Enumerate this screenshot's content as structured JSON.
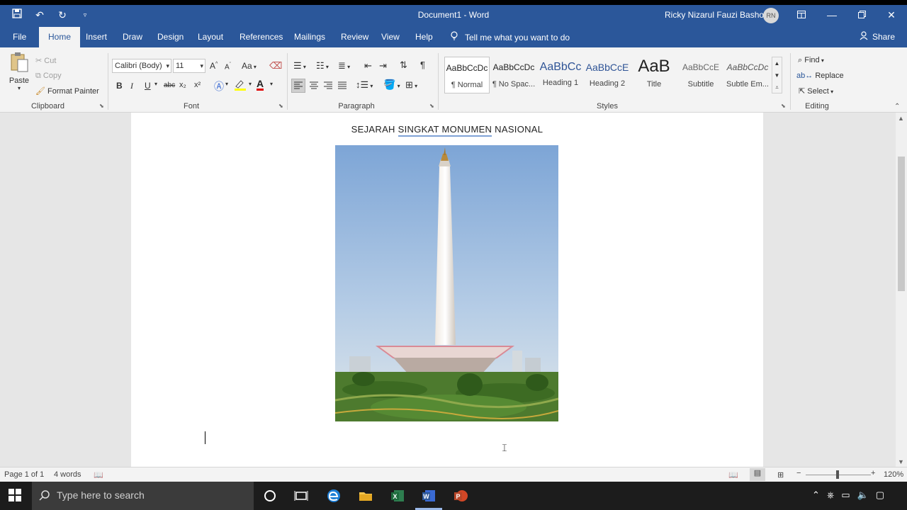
{
  "app": {
    "doc_title": "Document1 - Word",
    "user_name": "Ricky Nizarul Fauzi Bashori",
    "user_initials": "RN"
  },
  "tabs": [
    "File",
    "Home",
    "Insert",
    "Draw",
    "Design",
    "Layout",
    "References",
    "Mailings",
    "Review",
    "View",
    "Help"
  ],
  "active_tab": "Home",
  "tell_me": "Tell me what you want to do",
  "share": "Share",
  "clipboard": {
    "paste": "Paste",
    "cut": "Cut",
    "copy": "Copy",
    "format_painter": "Format Painter",
    "label": "Clipboard"
  },
  "font": {
    "name": "Calibri (Body)",
    "size": "11",
    "label": "Font",
    "bold": "B",
    "italic": "I",
    "underline": "U",
    "strike": "abc",
    "subscript": "x₂",
    "superscript": "x²",
    "change_case": "Aa",
    "font_color": "A"
  },
  "paragraph": {
    "label": "Paragraph"
  },
  "styles": {
    "label": "Styles",
    "items": [
      {
        "preview": "AaBbCcDc",
        "name": "¶ Normal"
      },
      {
        "preview": "AaBbCcDc",
        "name": "¶ No Spac..."
      },
      {
        "preview": "AaBbCc",
        "name": "Heading 1"
      },
      {
        "preview": "AaBbCcE",
        "name": "Heading 2"
      },
      {
        "preview": "AaB",
        "name": "Title"
      },
      {
        "preview": "AaBbCcE",
        "name": "Subtitle"
      },
      {
        "preview": "AaBbCcDc",
        "name": "Subtle Em..."
      }
    ]
  },
  "editing": {
    "label": "Editing",
    "find": "Find",
    "replace": "Replace",
    "select": "Select"
  },
  "document": {
    "title_pre": "SEJARAH ",
    "title_mid": "SINGKAT  MONUMEN",
    "title_post": "  NASIONAL"
  },
  "status": {
    "page": "Page 1 of 1",
    "words": "4 words",
    "zoom": "120%"
  },
  "taskbar": {
    "search_placeholder": "Type here to search"
  },
  "colors": {
    "word_blue": "#2b579a",
    "ribbon_bg": "#f3f3f3",
    "taskbar_bg": "#1c1c1c"
  }
}
